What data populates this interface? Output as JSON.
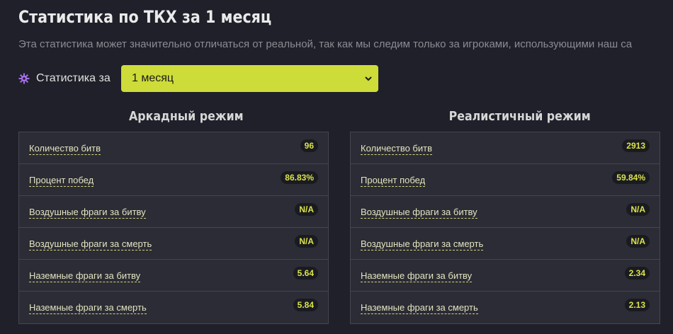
{
  "header": {
    "title": "Статистика по ТКХ за 1 месяц",
    "subtitle": "Эта статистика может значительно отличаться от реальной, так как мы следим только за игроками, использующими наш са"
  },
  "filter": {
    "icon": "gear-icon",
    "label": "Статистика за",
    "selected": "1 месяц"
  },
  "arcade": {
    "title": "Аркадный режим",
    "rows": [
      {
        "label": "Количество битв",
        "value": "96"
      },
      {
        "label": "Процент побед",
        "value": "86.83%"
      },
      {
        "label": "Воздушные фраги за битву",
        "value": "N/A"
      },
      {
        "label": "Воздушные фраги за смерть",
        "value": "N/A"
      },
      {
        "label": "Наземные фраги за битву",
        "value": "5.64"
      },
      {
        "label": "Наземные фраги за смерть",
        "value": "5.84"
      }
    ]
  },
  "realistic": {
    "title": "Реалистичный режим",
    "rows": [
      {
        "label": "Количество битв",
        "value": "2913"
      },
      {
        "label": "Процент побед",
        "value": "59.84%"
      },
      {
        "label": "Воздушные фраги за битву",
        "value": "N/A"
      },
      {
        "label": "Воздушные фраги за смерть",
        "value": "N/A"
      },
      {
        "label": "Наземные фраги за битву",
        "value": "2.34"
      },
      {
        "label": "Наземные фраги за смерть",
        "value": "2.13"
      }
    ]
  },
  "colors": {
    "accent": "#cddc39",
    "background": "#1f2029",
    "panel": "#2b2c35",
    "icon": "#a46ee6"
  }
}
